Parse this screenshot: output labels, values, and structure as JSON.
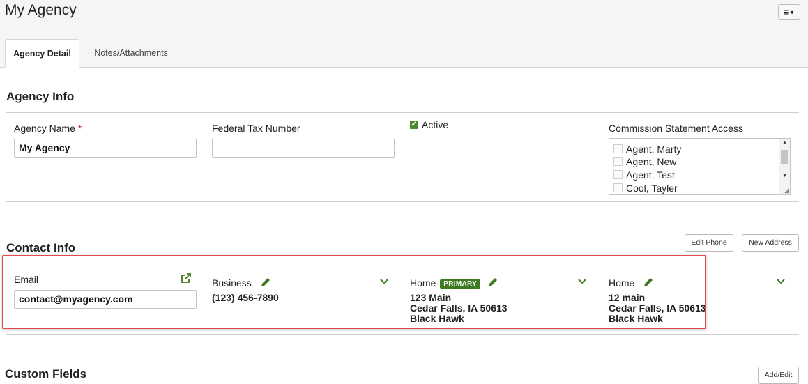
{
  "header": {
    "title": "My Agency",
    "menu_icon": "hamburger-menu-icon",
    "menu_glyph": "≡",
    "caret_glyph": "▼"
  },
  "tabs": [
    {
      "label": "Agency Detail",
      "active": true
    },
    {
      "label": "Notes/Attachments",
      "active": false
    }
  ],
  "agency_info": {
    "title": "Agency Info",
    "agency_name_label": "Agency Name",
    "required_mark": "*",
    "agency_name_value": "My Agency",
    "federal_tax_label": "Federal Tax Number",
    "federal_tax_value": "",
    "active_label": "Active",
    "active_checked": true,
    "commission_label": "Commission Statement Access",
    "commission_items": [
      "Agent, Marty",
      "Agent, New",
      "Agent, Test",
      "Cool, Tayler"
    ]
  },
  "contact_info": {
    "title": "Contact Info",
    "edit_phone_label": "Edit Phone",
    "new_address_label": "New Address",
    "email_label": "Email",
    "email_value": "contact@myagency.com",
    "phone": {
      "type": "Business",
      "number": "(123) 456-7890"
    },
    "addresses": [
      {
        "type": "Home",
        "badge": "PRIMARY",
        "line1": "123 Main",
        "line2": "Cedar Falls, IA 50613",
        "line3": "Black Hawk"
      },
      {
        "type": "Home",
        "badge": "",
        "line1": "12 main",
        "line2": "Cedar Falls, IA 50613",
        "line3": "Black Hawk"
      }
    ]
  },
  "custom_fields": {
    "title": "Custom Fields",
    "add_edit_label": "Add/Edit"
  },
  "colors": {
    "accent_green": "#3f7a23",
    "highlight_red": "#e14b4b"
  }
}
